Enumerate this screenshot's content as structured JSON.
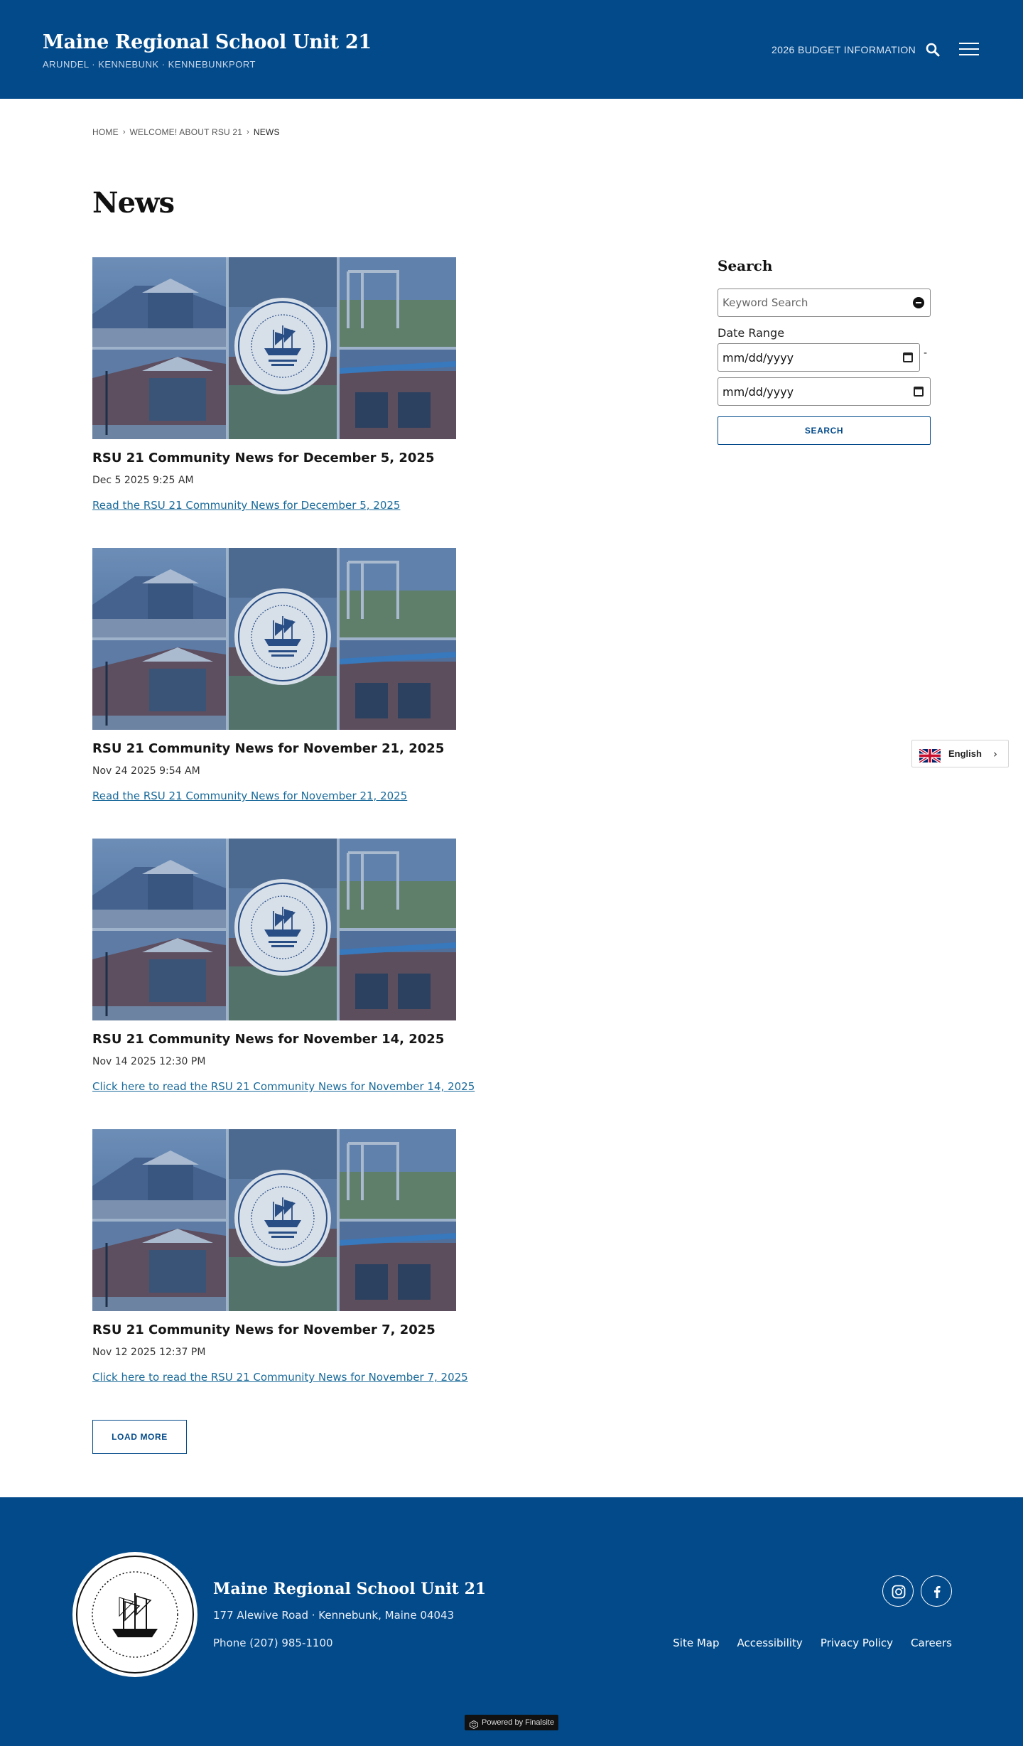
{
  "header": {
    "title": "Maine Regional School Unit 21",
    "subtitle": "ARUNDEL · KENNEBUNK · KENNEBUNKPORT",
    "budget_link": "2026 BUDGET INFORMATION",
    "search_icon": "search-icon",
    "menu_icon": "hamburger-menu-icon"
  },
  "breadcrumb": {
    "items": [
      "HOME",
      "WELCOME! ABOUT RSU 21",
      "NEWS"
    ]
  },
  "page": {
    "title": "News"
  },
  "news": [
    {
      "title": "RSU 21 Community News for December 5, 2025",
      "date": "Dec 5 2025 9:25 AM",
      "link": "Read the RSU 21 Community News for December 5, 2025"
    },
    {
      "title": "RSU 21 Community News for November 21, 2025",
      "date": "Nov 24 2025 9:54 AM",
      "link": "Read the RSU 21 Community News for November 21, 2025"
    },
    {
      "title": "RSU 21 Community News for November 14, 2025",
      "date": "Nov 14 2025 12:30 PM",
      "link": "Click here to read the RSU 21 Community News for November 14, 2025"
    },
    {
      "title": "RSU 21 Community News for November 7, 2025",
      "date": "Nov 12 2025 12:37 PM",
      "link": "Click here to read the RSU 21 Community News for November 7, 2025"
    }
  ],
  "load_more": "LOAD MORE",
  "sidebar": {
    "title": "Search",
    "keyword_placeholder": "Keyword Search",
    "date_range_label": "Date Range",
    "date_start_placeholder": "mm/dd/yyyy",
    "date_end_placeholder": "mm/dd/yyyy",
    "dash": "-",
    "search_button": "SEARCH"
  },
  "language": {
    "label": "English",
    "flag_icon": "uk-flag-icon"
  },
  "footer": {
    "name": "Maine Regional School Unit 21",
    "address": "177 Alewive Road  ·  Kennebunk, Maine  04043",
    "phone": "Phone (207) 985-1100",
    "links": [
      "Site Map",
      "Accessibility",
      "Privacy Policy",
      "Careers"
    ],
    "social_icons": [
      "instagram-icon",
      "facebook-icon"
    ],
    "powered_by": "Powered by Finalsite"
  },
  "colors": {
    "brand_blue": "#034a8a",
    "link_blue": "#1a6a9a"
  }
}
